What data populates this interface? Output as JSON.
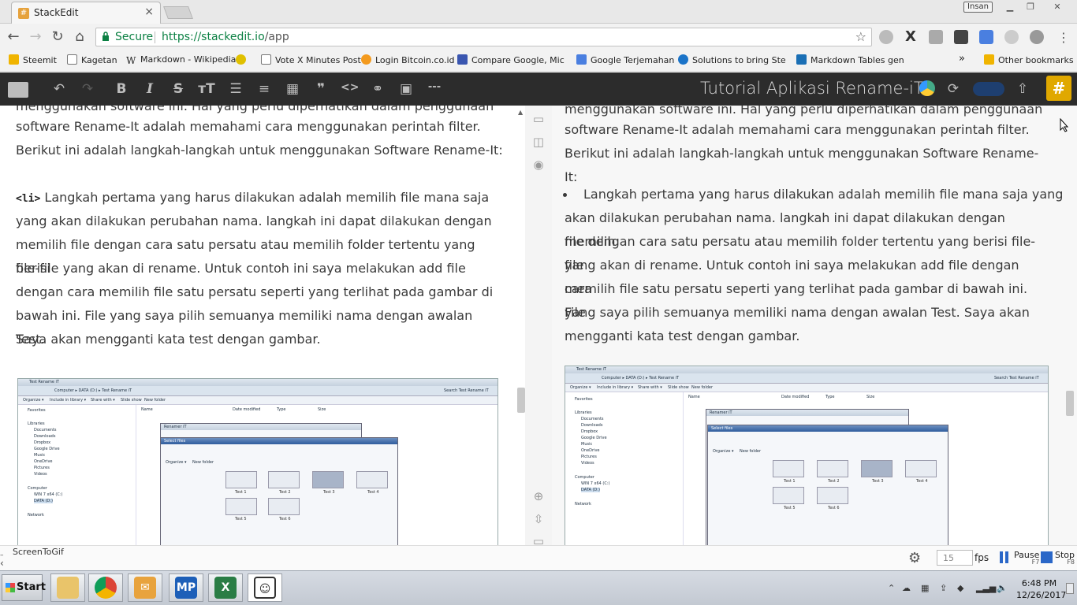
{
  "browser": {
    "tab_title": "StackEdit",
    "tab_close": "×",
    "profile_name": "Insan",
    "secure_label": "Secure",
    "url_host": "https://stackedit.io",
    "url_path": "/app",
    "bookmarks": [
      {
        "label": "Steemit",
        "icon": "folder-icon",
        "color": "#f0b400"
      },
      {
        "label": "Kagetan",
        "icon": "page-icon",
        "color": "#ffffff"
      },
      {
        "label": "Markdown - Wikipedia",
        "icon": "wikipedia-icon",
        "color": "#ffffff"
      },
      {
        "label": "",
        "icon": "emoji-icon",
        "color": "#e0c000"
      },
      {
        "label": "Vote X Minutes Post",
        "icon": "page-icon",
        "color": "#ffffff"
      },
      {
        "label": "Login Bitcoin.co.id",
        "icon": "bitcoin-icon",
        "color": "#f39a1e"
      },
      {
        "label": "Compare Google, Micro",
        "icon": "shield-icon",
        "color": "#3a56b0"
      },
      {
        "label": "Google Terjemahan",
        "icon": "translate-icon",
        "color": "#4a7fe0"
      },
      {
        "label": "Solutions to bring Steem",
        "icon": "steem-icon",
        "color": "#1a73c8"
      },
      {
        "label": "Markdown Tables gener",
        "icon": "table-icon",
        "color": "#1a6fb5"
      }
    ],
    "bookmarks_more": "»",
    "other_bookmarks": "Other bookmarks"
  },
  "stackedit": {
    "document_title": "Tutorial Aplikasi Rename-iT",
    "toolbar_buttons": [
      {
        "name": "folder-icon",
        "glyph": "▬"
      },
      {
        "name": "undo-icon",
        "glyph": "↶"
      },
      {
        "name": "redo-icon",
        "glyph": "↷"
      },
      {
        "name": "bold-icon",
        "glyph": "B"
      },
      {
        "name": "italic-icon",
        "glyph": "I"
      },
      {
        "name": "strikethrough-icon",
        "glyph": "S"
      },
      {
        "name": "heading-icon",
        "glyph": "тT"
      },
      {
        "name": "bullet-list-icon",
        "glyph": "☰"
      },
      {
        "name": "numbered-list-icon",
        "glyph": "≡"
      },
      {
        "name": "table-icon",
        "glyph": "▦"
      },
      {
        "name": "quote-icon",
        "glyph": "❞"
      },
      {
        "name": "code-icon",
        "glyph": "<>"
      },
      {
        "name": "link-icon",
        "glyph": "⚭"
      },
      {
        "name": "image-icon",
        "glyph": "▣"
      },
      {
        "name": "horizontal-rule-icon",
        "glyph": "---"
      }
    ]
  },
  "editor": {
    "line_partial": "menggunakan software ini. Hal yang perlu diperhatikan dalam penggunaan",
    "line_1": "software Rename-It adalah memahami cara menggunakan perintah filter.",
    "line_2": "Berikut ini adalah langkah-langkah untuk menggunakan Software Rename-It:",
    "li_tag": "<li>",
    "item_line_1": " Langkah pertama yang harus dilakukan adalah memilih file mana saja",
    "item_line_2": "yang akan dilakukan perubahan nama. langkah ini dapat dilakukan dengan",
    "item_line_3": "memilih file dengan cara satu persatu atau memilih folder tertentu yang berisi",
    "item_line_4": "file-file yang akan di rename. Untuk contoh ini saya melakukan add file",
    "item_line_5": "dengan cara memilih file satu persatu seperti yang terlihat pada gambar di",
    "item_line_6": "bawah ini. File yang saya pilih semuanya memiliki nama dengan awalan Test.",
    "item_line_7": "Saya akan mengganti kata test dengan  gambar."
  },
  "preview": {
    "line_partial": "menggunakan software ini. Hal yang perlu diperhatikan dalam penggunaan",
    "line_1": "software Rename-It adalah memahami cara menggunakan perintah filter.",
    "line_2": "Berikut ini adalah langkah-langkah untuk menggunakan Software Rename-It:",
    "item_line_1": "Langkah pertama yang harus dilakukan adalah memilih file mana saja yang",
    "item_line_2": "akan dilakukan perubahan nama. langkah ini dapat dilakukan dengan memilih",
    "item_line_3": "file dengan cara satu persatu atau memilih folder tertentu yang berisi file-file",
    "item_line_4": "yang akan di rename. Untuk contoh ini saya melakukan add file dengan cara",
    "item_line_5": "memilih file satu persatu seperti yang terlihat pada gambar di bawah ini. File",
    "item_line_6": "yang saya pilih semuanya memiliki nama dengan awalan Test. Saya akan",
    "item_line_7": "mengganti kata test dengan gambar."
  },
  "embedded_screenshot": {
    "window_title": "Test Rename iT",
    "breadcrumb": "Computer ▸ DATA (D:) ▸ Test Rename iT",
    "search": "Search Test Rename iT",
    "commands": [
      "Organize ▾",
      "Include in library ▾",
      "Share with ▾",
      "Slide show",
      "New folder"
    ],
    "columns": [
      "Name",
      "Date modified",
      "Type",
      "Size"
    ],
    "nav_items": [
      "Favorites",
      "Libraries",
      "Documents",
      "Downloads",
      "Dropbox",
      "Google Drive",
      "Music",
      "OneDrive",
      "Pictures",
      "Videos",
      "Computer",
      "WIN 7 x64 (C:)",
      "DATA (D:)",
      "Network"
    ],
    "renamer_title": "Renamer iT",
    "dialog_title": "Select files",
    "dialog_commands": [
      "Organize ▾",
      "New folder"
    ],
    "thumbs": [
      "Test 1",
      "Test 2",
      "Test 3",
      "Test 4",
      "Test 5",
      "Test 6"
    ]
  },
  "recorder": {
    "title": "ScreenToGif",
    "fps_value": "15",
    "fps_label": "fps",
    "pause_label": "Pause",
    "pause_key": "F7",
    "stop_label": "Stop",
    "stop_key": "F8"
  },
  "taskbar": {
    "start_label": "Start",
    "apps": [
      "explorer",
      "chrome",
      "outlook",
      "MP",
      "excel",
      "screentogif"
    ],
    "mp_label": "MP",
    "time": "6:48 PM",
    "date": "12/26/2017"
  }
}
